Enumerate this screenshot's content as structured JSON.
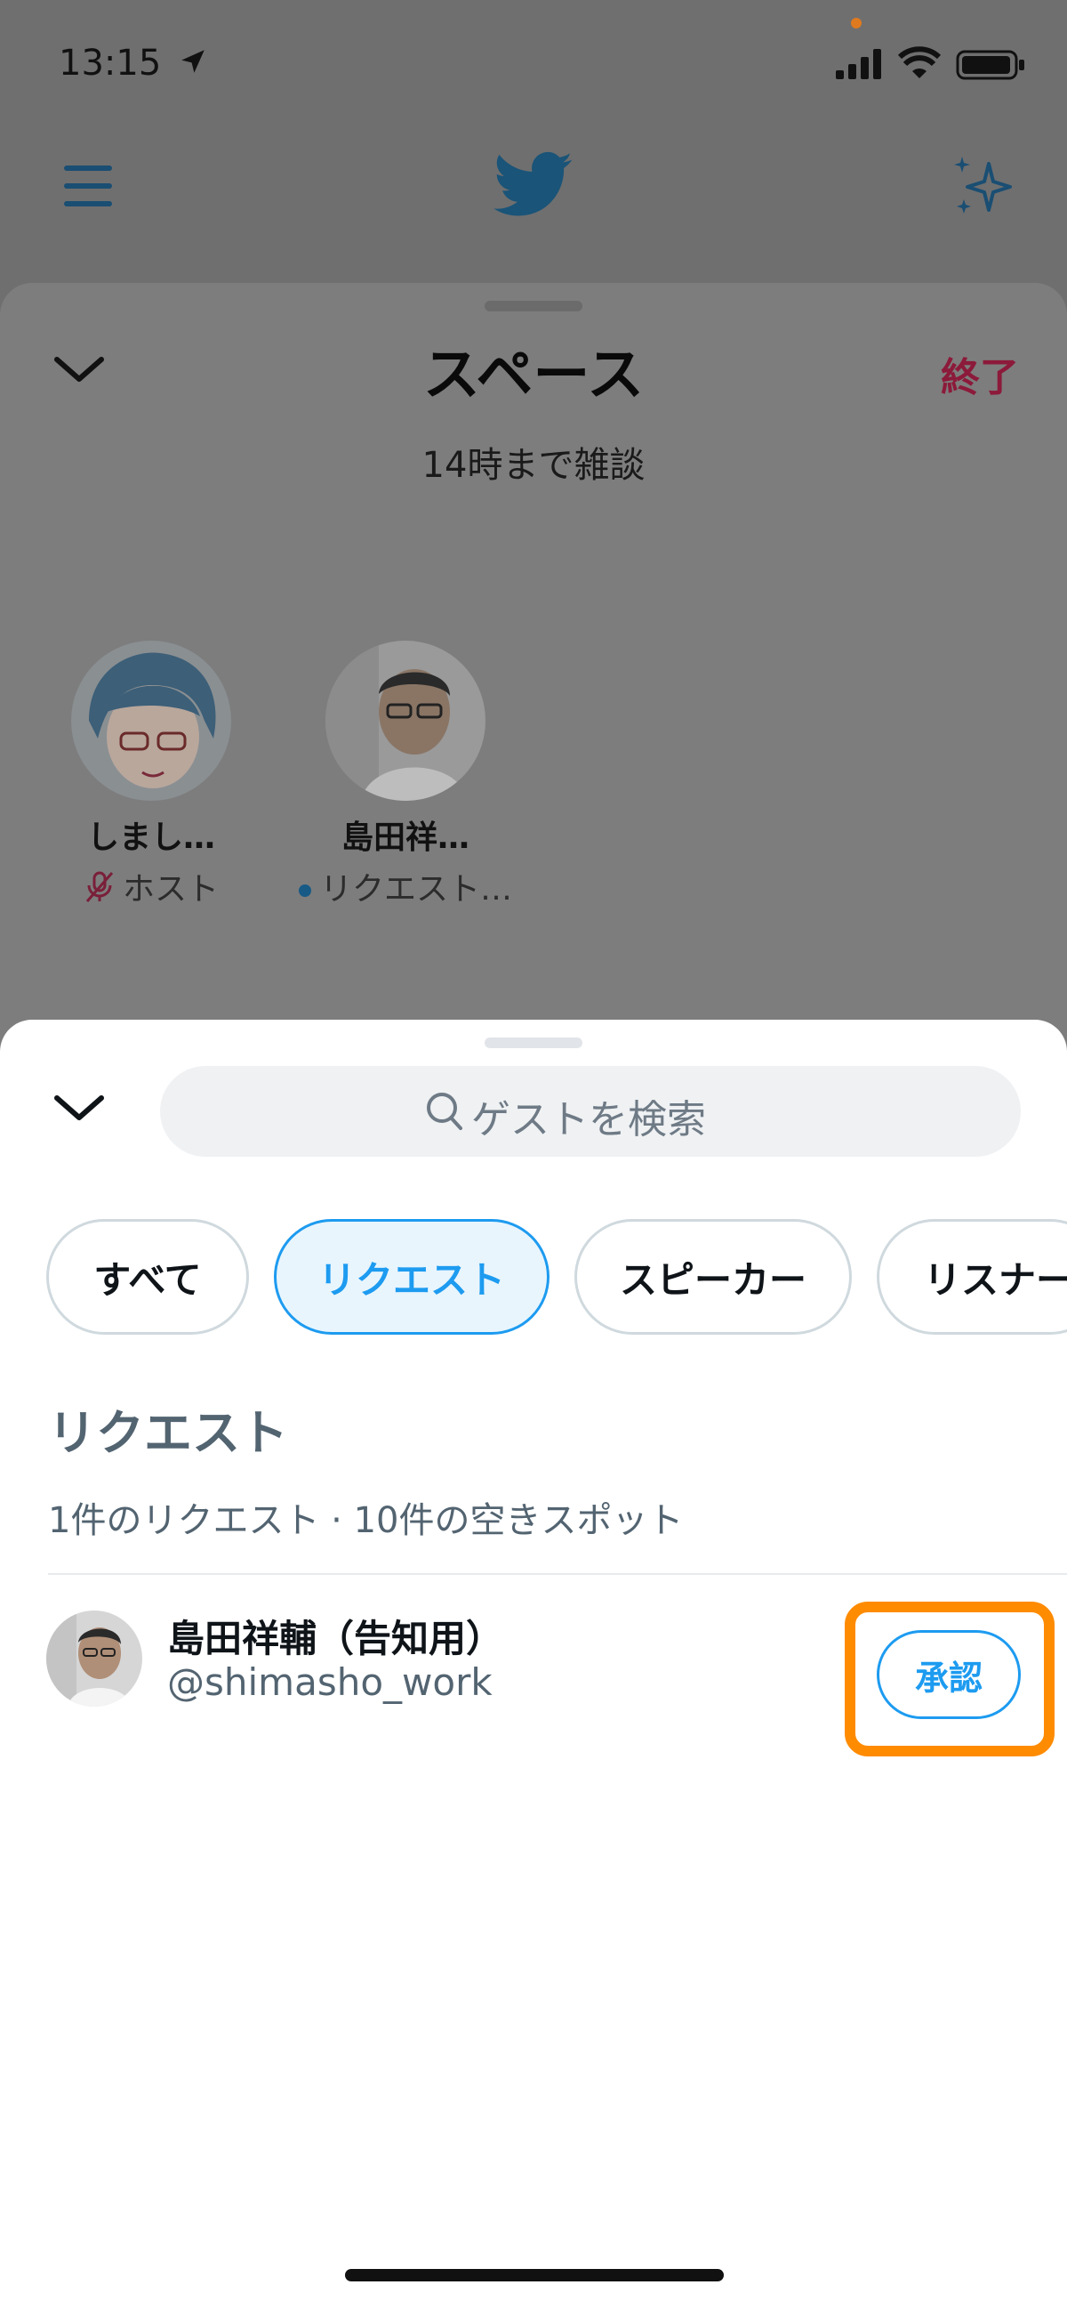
{
  "status_bar": {
    "time": "13:15"
  },
  "space": {
    "title": "スペース",
    "subtitle": "14時まで雑談",
    "end_label": "終了",
    "participants": [
      {
        "name": "しまし…",
        "role": "ホスト"
      },
      {
        "name": "島田祥…",
        "role": "リクエスト…"
      }
    ]
  },
  "guest_panel": {
    "search_placeholder": "ゲストを検索",
    "tabs": [
      {
        "label": "すべて",
        "active": false
      },
      {
        "label": "リクエスト",
        "active": true
      },
      {
        "label": "スピーカー",
        "active": false
      },
      {
        "label": "リスナー",
        "active": false
      }
    ],
    "section_title": "リクエスト",
    "section_subtitle": "1件のリクエスト · 10件の空きスポット",
    "requests": [
      {
        "name": "島田祥輔（告知用）",
        "handle": "@shimasho_work",
        "action": "承認"
      }
    ]
  },
  "colors": {
    "accent": "#1d9bf0",
    "highlight": "#ff8b00",
    "end": "#8c1a3a"
  }
}
